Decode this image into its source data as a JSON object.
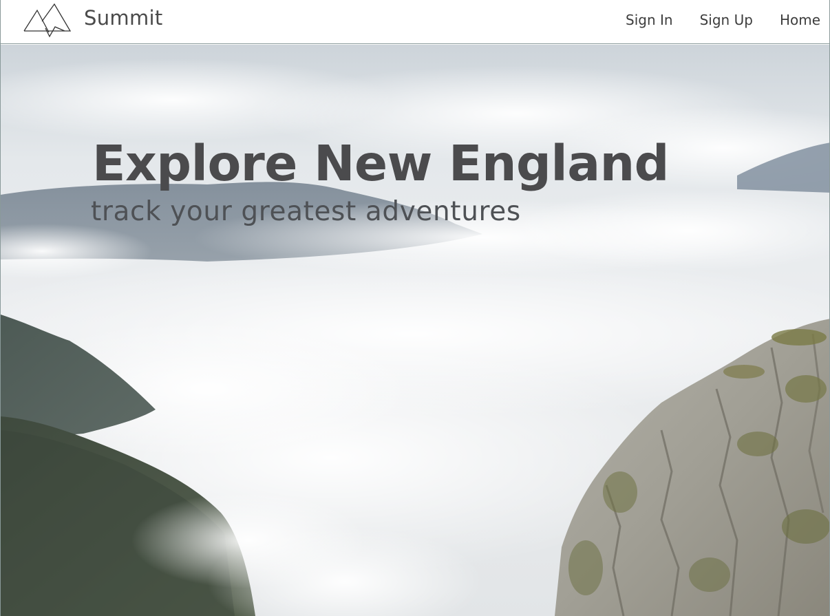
{
  "brand": {
    "name": "Summit",
    "logo_icon": "mountain-peaks-icon"
  },
  "nav": {
    "items": [
      {
        "label": "Sign In"
      },
      {
        "label": "Sign Up"
      },
      {
        "label": "Home"
      }
    ]
  },
  "hero": {
    "title": "Explore New England",
    "subtitle": "track your greatest adventures",
    "background_image": "mountains-above-clouds"
  },
  "colors": {
    "text_dark": "#4b4b4d",
    "nav_text": "#3d3d3d",
    "border": "#8a9a9a"
  }
}
